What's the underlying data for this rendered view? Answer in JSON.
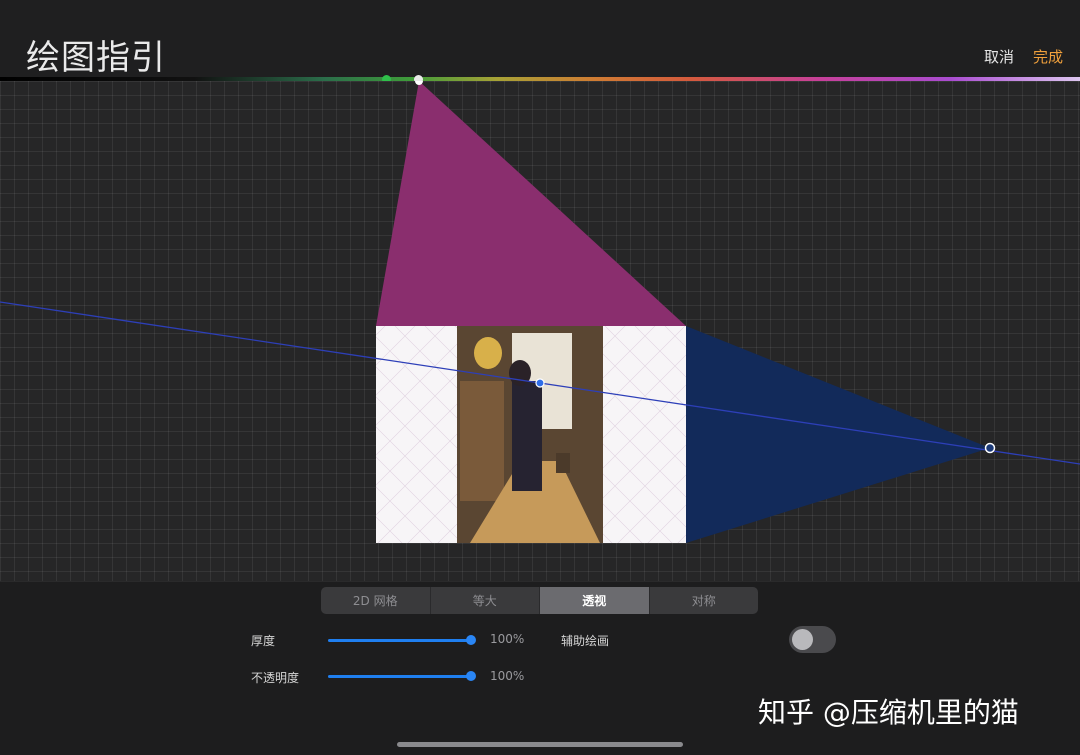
{
  "header": {
    "title": "绘图指引",
    "cancel_label": "取消",
    "done_label": "完成"
  },
  "tabs": [
    {
      "label": "2D 网格",
      "active": false
    },
    {
      "label": "等大",
      "active": false
    },
    {
      "label": "透视",
      "active": true
    },
    {
      "label": "对称",
      "active": false
    }
  ],
  "controls": {
    "thickness": {
      "label": "厚度",
      "value_text": "100%",
      "value": 1.0
    },
    "opacity": {
      "label": "不透明度",
      "value_text": "100%",
      "value": 1.0
    },
    "assisted_drawing": {
      "label": "辅助绘画",
      "enabled": false
    }
  },
  "watermark": "知乎 @压缩机里的猫",
  "colors": {
    "accent": "#f0a03c",
    "slider": "#1f7ff0",
    "plane_magenta": "#8a2e6e",
    "plane_blue": "#122a5a",
    "horizon_line": "#2d3fb8"
  }
}
